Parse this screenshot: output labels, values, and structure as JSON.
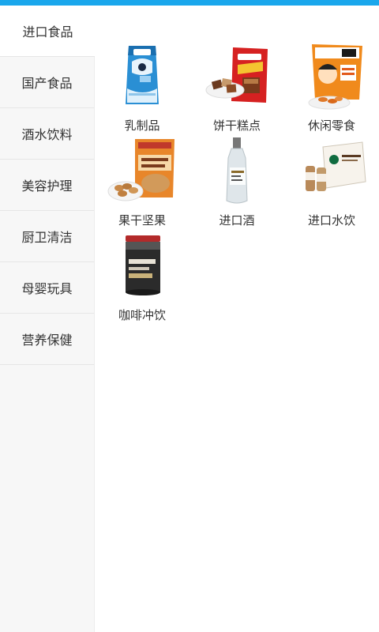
{
  "sidebar": {
    "items": [
      {
        "label": "进口食品",
        "active": true
      },
      {
        "label": "国产食品",
        "active": false
      },
      {
        "label": "酒水饮料",
        "active": false
      },
      {
        "label": "美容护理",
        "active": false
      },
      {
        "label": "厨卫清洁",
        "active": false
      },
      {
        "label": "母婴玩具",
        "active": false
      },
      {
        "label": "营养保健",
        "active": false
      }
    ]
  },
  "categories": [
    {
      "label": "乳制品",
      "icon": "milk-powder-bag-icon"
    },
    {
      "label": "饼干糕点",
      "icon": "wafer-biscuit-bag-icon"
    },
    {
      "label": "休闲零食",
      "icon": "snack-bag-icon"
    },
    {
      "label": "果干坚果",
      "icon": "cashew-nuts-icon"
    },
    {
      "label": "进口酒",
      "icon": "vodka-bottle-icon"
    },
    {
      "label": "进口水饮",
      "icon": "coffee-drink-box-icon"
    },
    {
      "label": "咖啡冲饮",
      "icon": "coffee-can-icon"
    }
  ],
  "colors": {
    "accent": "#1aa7ec"
  }
}
